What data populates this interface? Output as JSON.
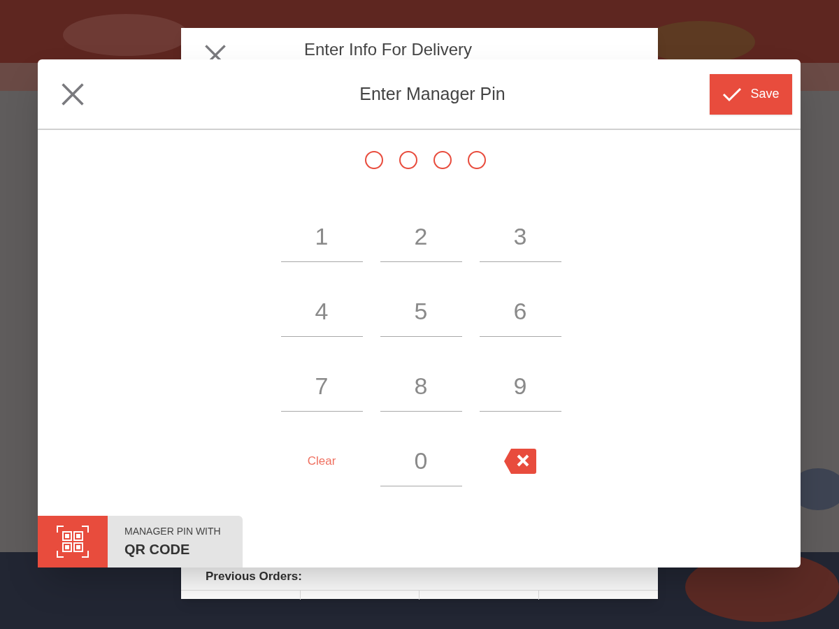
{
  "background_dialog": {
    "title": "Enter Info For Delivery",
    "section_label": "Previous Orders:"
  },
  "dialog": {
    "title": "Enter Manager Pin",
    "save_label": "Save"
  },
  "pin_dots": [
    {
      "filled": false
    },
    {
      "filled": false
    },
    {
      "filled": false
    },
    {
      "filled": false
    }
  ],
  "keypad": [
    {
      "kind": "digit",
      "label": "1"
    },
    {
      "kind": "digit",
      "label": "2"
    },
    {
      "kind": "digit",
      "label": "3"
    },
    {
      "kind": "digit",
      "label": "4"
    },
    {
      "kind": "digit",
      "label": "5"
    },
    {
      "kind": "digit",
      "label": "6"
    },
    {
      "kind": "digit",
      "label": "7"
    },
    {
      "kind": "digit",
      "label": "8"
    },
    {
      "kind": "digit",
      "label": "9"
    },
    {
      "kind": "clear",
      "label": "Clear"
    },
    {
      "kind": "digit",
      "label": "0"
    },
    {
      "kind": "backspace"
    }
  ],
  "qr_option": {
    "line_1": "MANAGER PIN WITH",
    "line_2": "QR CODE"
  }
}
